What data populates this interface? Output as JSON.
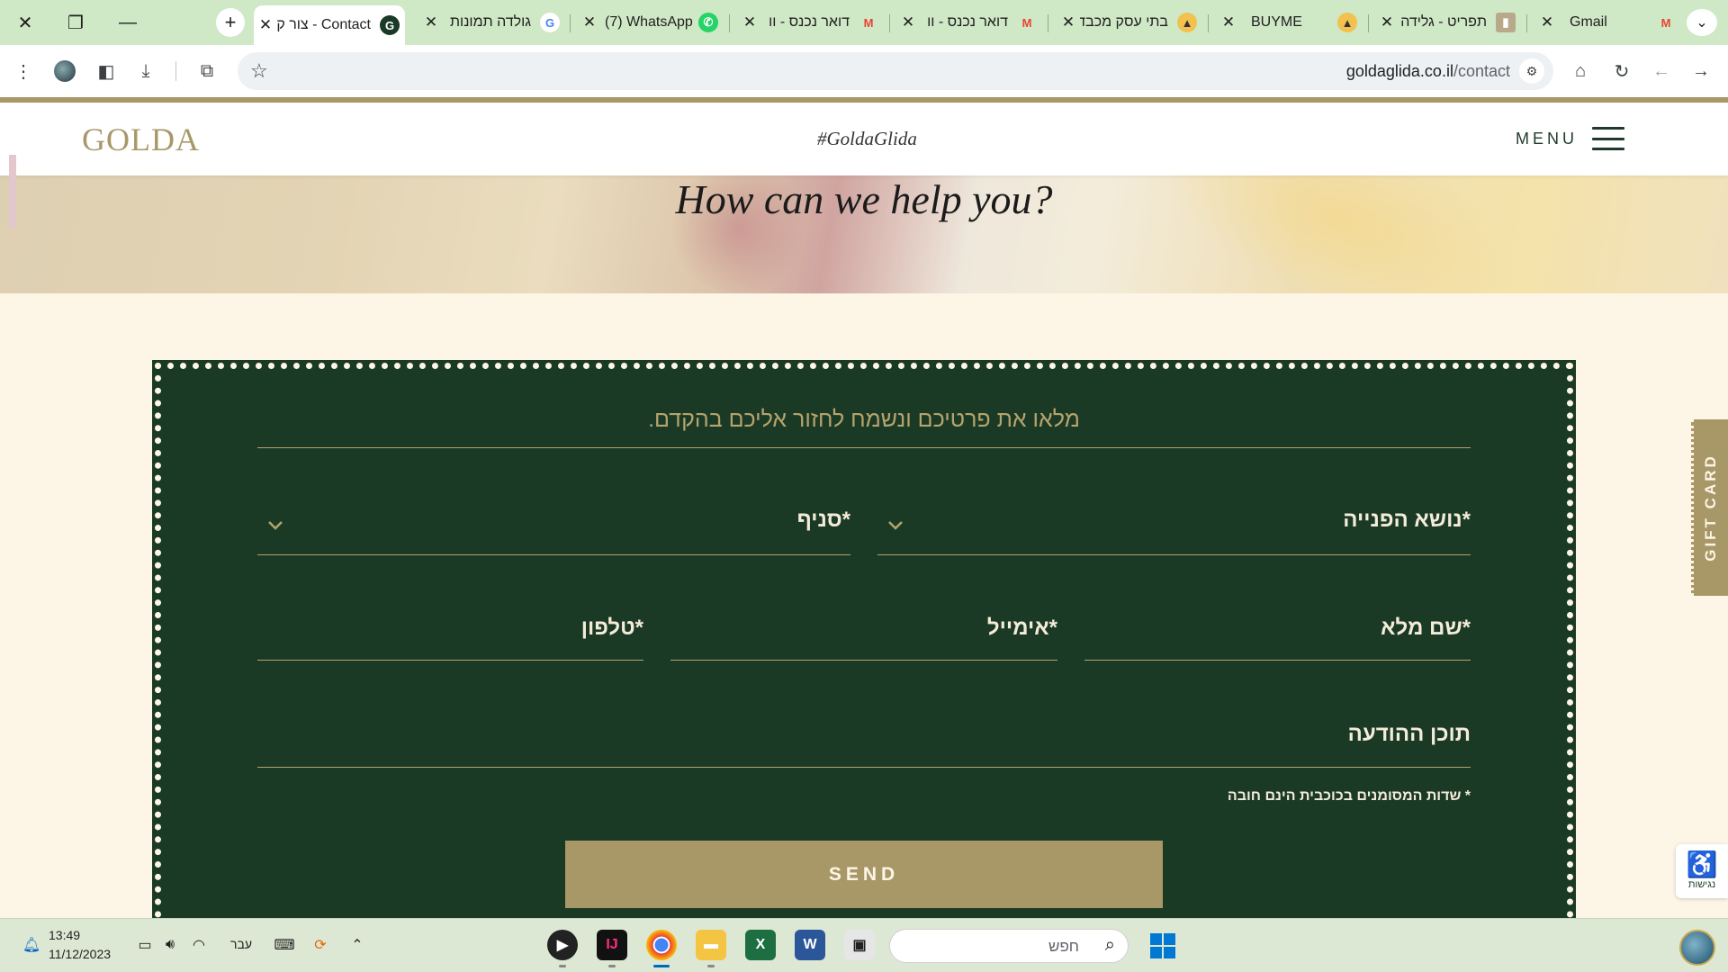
{
  "browser": {
    "tabs": [
      {
        "title": "Gmail",
        "icon": "gmail-icon",
        "active": false
      },
      {
        "title": "תפריט - גלידה",
        "icon": "page-icon",
        "active": false
      },
      {
        "title": "BUYME",
        "icon": "buyme-icon",
        "active": false
      },
      {
        "title": "בתי עסק מכבדים",
        "icon": "buyme-icon",
        "active": false
      },
      {
        "title": "דואר נכנס - וו",
        "icon": "gmail-icon",
        "active": false
      },
      {
        "title": "דואר נכנס - וו",
        "icon": "gmail-icon",
        "active": false
      },
      {
        "title": "(7) WhatsApp",
        "icon": "whatsapp-icon",
        "active": false
      },
      {
        "title": "גולדה תמונות",
        "icon": "google-icon",
        "active": false
      },
      {
        "title": "Contact - צור קשר",
        "icon": "golda-icon",
        "active": true
      }
    ],
    "url_domain": "goldaglida.co.il",
    "url_path": "/contact"
  },
  "site": {
    "logo": "GOLDA",
    "hashtag": "#GoldaGlida",
    "menu_label": "MENU",
    "hero_title": "How can we help you?",
    "gift_card": "GIFT CARD",
    "accessibility_label": "נגישות"
  },
  "form": {
    "heading": "מלאו את פרטיכם ונשמח לחזור אליכם בהקדם.",
    "subject_label": "*נושא הפנייה",
    "branch_label": "*סניף",
    "name_label": "*שם מלא",
    "email_label": "*אימייל",
    "phone_label": "*טלפון",
    "message_label": "תוכן ההודעה",
    "required_note": "* שדות המסומנים בכוכבית הינם חובה",
    "send_label": "SEND"
  },
  "taskbar": {
    "time": "13:49",
    "date": "11/12/2023",
    "language": "עבר",
    "search_placeholder": "חפש"
  },
  "colors": {
    "brand_gold": "#a89868",
    "form_green": "#1a3a26",
    "page_cream": "#fdf5e6"
  }
}
